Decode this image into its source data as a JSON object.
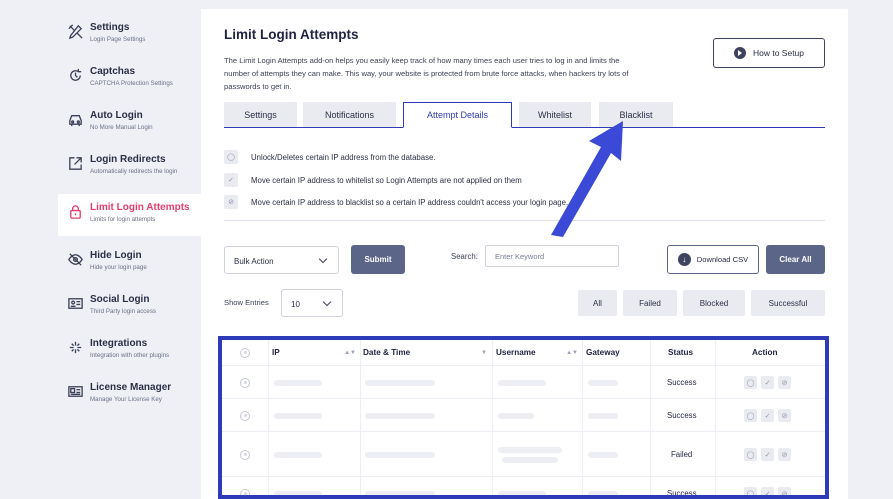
{
  "sidebar": {
    "items": [
      {
        "title": "Settings",
        "sub": "Login Page Settings",
        "icon": "tools-icon"
      },
      {
        "title": "Captchas",
        "sub": "CAPTCHA Protection Settings",
        "icon": "captcha-icon"
      },
      {
        "title": "Auto Login",
        "sub": "No More Manual Login",
        "icon": "car-icon"
      },
      {
        "title": "Login Redirects",
        "sub": "Automatically redirects the login",
        "icon": "redirect-icon"
      },
      {
        "title": "Limit Login Attempts",
        "sub": "Limits for login attempts",
        "icon": "lock-icon"
      },
      {
        "title": "Hide Login",
        "sub": "Hide your login page",
        "icon": "eye-off-icon"
      },
      {
        "title": "Social Login",
        "sub": "Third Party login access",
        "icon": "id-card-icon"
      },
      {
        "title": "Integrations",
        "sub": "Integration with other plugins",
        "icon": "integrations-icon"
      },
      {
        "title": "License Manager",
        "sub": "Manage Your License Key",
        "icon": "license-icon"
      }
    ]
  },
  "page": {
    "title": "Limit Login Attempts",
    "description": "The Limit Login Attempts add-on helps you easily keep track of how many times each user tries to log in and limits the number of attempts they can make. This way, your website is protected from brute force attacks, when hackers try lots of passwords to get in.",
    "how_to": "How to Setup"
  },
  "tabs": [
    "Settings",
    "Notifications",
    "Attempt Details",
    "Whitelist",
    "Blacklist"
  ],
  "info": [
    "Unlock/Deletes certain IP address from the database.",
    "Move certain IP address to whitelist so Login Attempts are not applied on them",
    "Move certain IP address to blacklist so a certain IP address couldn't access your login page."
  ],
  "controls": {
    "bulk_action": "Bulk Action",
    "submit": "Submit",
    "search_label": "Search:",
    "search_placeholder": "Enter Keyword",
    "download_csv": "Download CSV",
    "clear_all": "Clear All",
    "show_entries_label": "Show Entries",
    "show_entries_value": "10",
    "filters": [
      "All",
      "Failed",
      "Blocked",
      "Successful"
    ]
  },
  "table": {
    "headers": [
      "IP",
      "Date & Time",
      "Username",
      "Gateway",
      "Status",
      "Action"
    ],
    "rows": [
      {
        "status": "Success"
      },
      {
        "status": "Success"
      },
      {
        "status": "Failed"
      },
      {
        "status": "Success"
      }
    ]
  },
  "colors": {
    "accent": "#2e3bb8",
    "active_sidebar": "#e33e6c",
    "dark_button": "#5b6587"
  }
}
